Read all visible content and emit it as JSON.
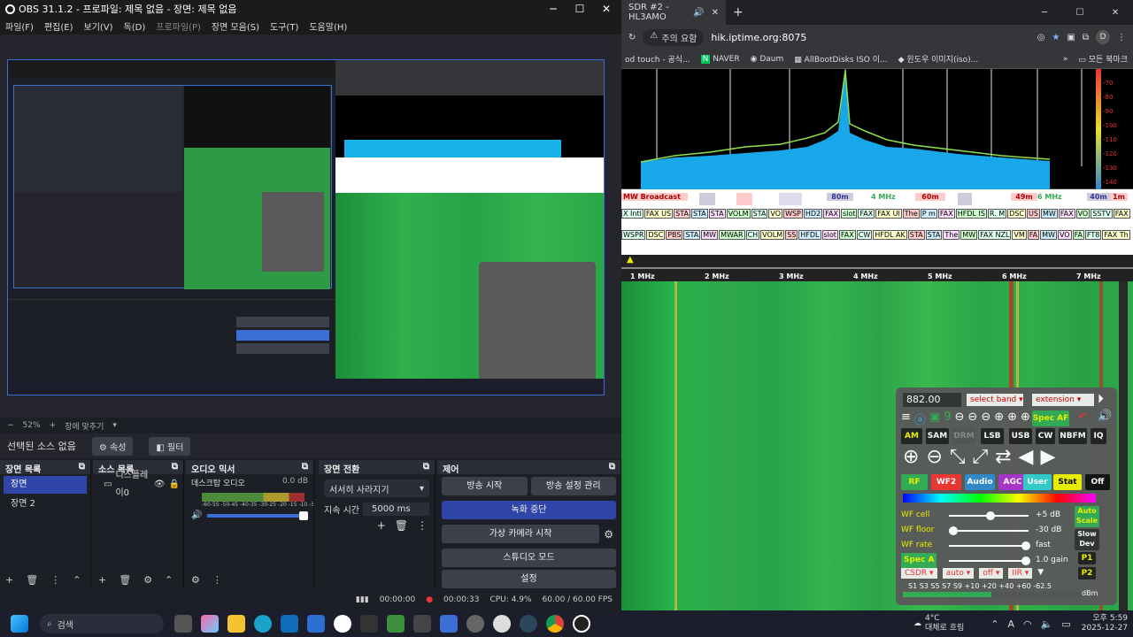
{
  "obs": {
    "title": "OBS 31.1.2 - 프로파일: 제목 없음 - 장면: 제목 없음",
    "menu": [
      "파일(F)",
      "편집(E)",
      "보기(V)",
      "독(D)",
      "프로파일(P)",
      "장면 모음(S)",
      "도구(T)",
      "도움말(H)"
    ],
    "zoom": "52%",
    "fit": "창에 맞추기",
    "no_source": "선택된 소스 없음",
    "properties": "속성",
    "filters": "필터",
    "scenes": {
      "title": "장면 목록",
      "items": [
        "장면",
        "장면 2"
      ]
    },
    "sources": {
      "title": "소스 목록",
      "items": [
        "디스플레이0"
      ]
    },
    "mixer": {
      "title": "오디오 믹서",
      "track": "데스크탑 오디오",
      "db": "0.0 dB",
      "scale": "-60-55 -50-45 -40-35 -30-25 -20 -15 -10 -5 -0"
    },
    "transitions": {
      "title": "장면 전환",
      "type": "서서히 사라지기",
      "duration_label": "지속 시간",
      "duration": "5000 ms"
    },
    "controls": {
      "title": "제어",
      "start_stream": "방송 시작",
      "stream_settings": "방송 설정 관리",
      "stop_rec": "녹화 중단",
      "virtual_cam": "가상 카메라 시작",
      "studio": "스튜디오 모드",
      "settings": "설정"
    },
    "status": {
      "stream_time": "00:00:00",
      "rec_time": "00:00:33",
      "cpu": "CPU: 4.9%",
      "fps": "60.00 / 60.00 FPS"
    }
  },
  "browser": {
    "tab": "SDR #2 - HL3AMO",
    "warning": "주의 요함",
    "url": "hik.iptime.org:8075",
    "profile": "D",
    "bookmarks": [
      "od touch - 공식...",
      "NAVER",
      "Daum",
      "AllBootDisks ISO 이...",
      "윈도우 이미지(iso)..."
    ],
    "bookmarks_right": "모든 북마크",
    "db_scale": [
      "-70",
      "-80",
      "-90",
      "-100",
      "-110",
      "-120",
      "-130",
      "-140"
    ],
    "band_row1": [
      "MW Broadcast",
      "80m",
      "4 MHz",
      "60m",
      "49m",
      "6 MHz",
      "40m",
      "1m"
    ],
    "band_row2": [
      "X Intl",
      "FAX US",
      "STA",
      "STA",
      "STA",
      "VOLM",
      "STA",
      "VO",
      "WSP",
      "HD2",
      "FAX",
      "slot",
      "FAX",
      "FAX UI",
      "The",
      "P m",
      "FAX",
      "HFDL IS",
      "R. M",
      "DSC",
      "US",
      "MW",
      "FAX",
      "VO",
      "SSTV",
      "FAX"
    ],
    "band_row3": [
      "WSPR",
      "DSC",
      "PBS",
      "STA",
      "MW",
      "MWAR",
      "CH",
      "VOLM",
      "SS",
      "HFDL",
      "slot",
      "FAX",
      "CW",
      "HFDL AK",
      "STA",
      "STA",
      "The",
      "MW",
      "FAX NZL",
      "VM",
      "FA",
      "MW",
      "VO",
      "FA",
      "FT8",
      "FAX Th"
    ],
    "freq_ticks": [
      "1 MHz",
      "2 MHz",
      "3 MHz",
      "4 MHz",
      "5 MHz",
      "6 MHz",
      "7 MHz"
    ],
    "panel": {
      "freq": "882.00",
      "band": "select band",
      "ext": "extension",
      "spec_af": "Spec AF",
      "modes": [
        "AM",
        "SAM",
        "DRM",
        "LSB",
        "USB",
        "CW",
        "NBFM",
        "IQ"
      ],
      "colors": [
        "RF",
        "WF2",
        "Audio",
        "AGC",
        "User",
        "Stat",
        "Off"
      ],
      "wf_cell": "WF cell",
      "wf_cell_v": "+5 dB",
      "wf_floor": "WF floor",
      "wf_floor_v": "-30 dB",
      "wf_rate": "WF rate",
      "wf_rate_v": "fast",
      "spec_a": "Spec A",
      "spec_a_v": "1.0 gain",
      "auto_scale": "Auto Scale",
      "slow_dev": "Slow Dev",
      "p1": "P1",
      "p2": "P2",
      "sel": [
        "CSDR",
        "auto",
        "off",
        "IIR"
      ],
      "smeter": "S1  S3  S5  S7  S9 +10 +20  +40  +60 -62.5",
      "dbm": "dBm"
    }
  },
  "taskbar": {
    "search": "검색",
    "weather_temp": "4°C",
    "weather_text": "대체로 흐림",
    "time": "오후 5:59",
    "date": "2025-12-27"
  }
}
